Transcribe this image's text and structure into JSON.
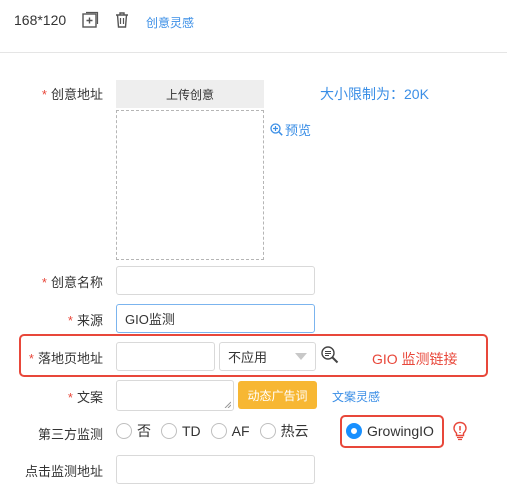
{
  "toolbar": {
    "size_label": "168*120",
    "add_icon": "add-square-icon",
    "delete_icon": "trash-icon",
    "inspiration_link": "创意灵感"
  },
  "form": {
    "creative_url": {
      "required_mark": "*",
      "label": "创意地址",
      "upload_button": "上传创意",
      "size_limit": "大小限制为：20K",
      "preview": "预览"
    },
    "creative_name": {
      "required_mark": "*",
      "label": "创意名称",
      "value": ""
    },
    "source": {
      "required_mark": "*",
      "label": "来源",
      "value": "GIO监测"
    },
    "landing_page": {
      "required_mark": "*",
      "label": "落地页地址",
      "value": "",
      "select_value": "不应用",
      "annotation": "GIO 监测链接"
    },
    "copy": {
      "required_mark": "*",
      "label": "文案",
      "value": "",
      "dynamic_button": "动态广告词",
      "copy_inspiration": "文案灵感"
    },
    "third_party_tracking": {
      "label": "第三方监测",
      "options": [
        "否",
        "TD",
        "AF",
        "热云",
        "GrowingIO"
      ],
      "selected": "GrowingIO"
    },
    "click_tracking": {
      "label": "点击监测地址",
      "value": ""
    }
  },
  "colors": {
    "link": "#3a8ee6",
    "required": "#e8473a",
    "highlight_border": "#e8473a",
    "radio_selected": "#1890ff",
    "dynamic_button_bg": "#f7b733"
  }
}
